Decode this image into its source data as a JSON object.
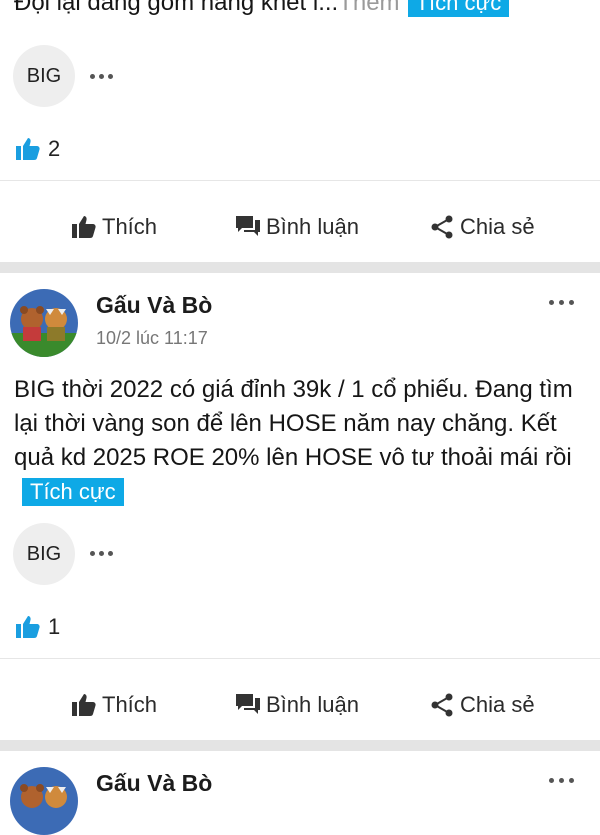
{
  "post0": {
    "text_partial": "Đội lại đang gom hàng khét l...",
    "see_more": "Thêm",
    "tag": "Tích cực",
    "chip": "BIG",
    "likes": "2"
  },
  "actions": {
    "like": "Thích",
    "comment": "Bình luận",
    "share": "Chia sẻ"
  },
  "post1": {
    "author": "Gấu Và Bò",
    "time": "10/2 lúc 11:17",
    "text": "BIG thời 2022 có giá đỉnh 39k / 1 cổ phiếu. Đang tìm lại thời vàng son để lên HOSE năm nay chăng. Kết quả kd 2025 ROE 20% lên HOSE vô tư thoải mái rồi",
    "tag": "Tích cực",
    "chip": "BIG",
    "likes": "1"
  },
  "post2": {
    "author": "Gấu Và Bò"
  },
  "colors": {
    "accent": "#0ea9e6",
    "like_icon": "#1a9ee0"
  }
}
